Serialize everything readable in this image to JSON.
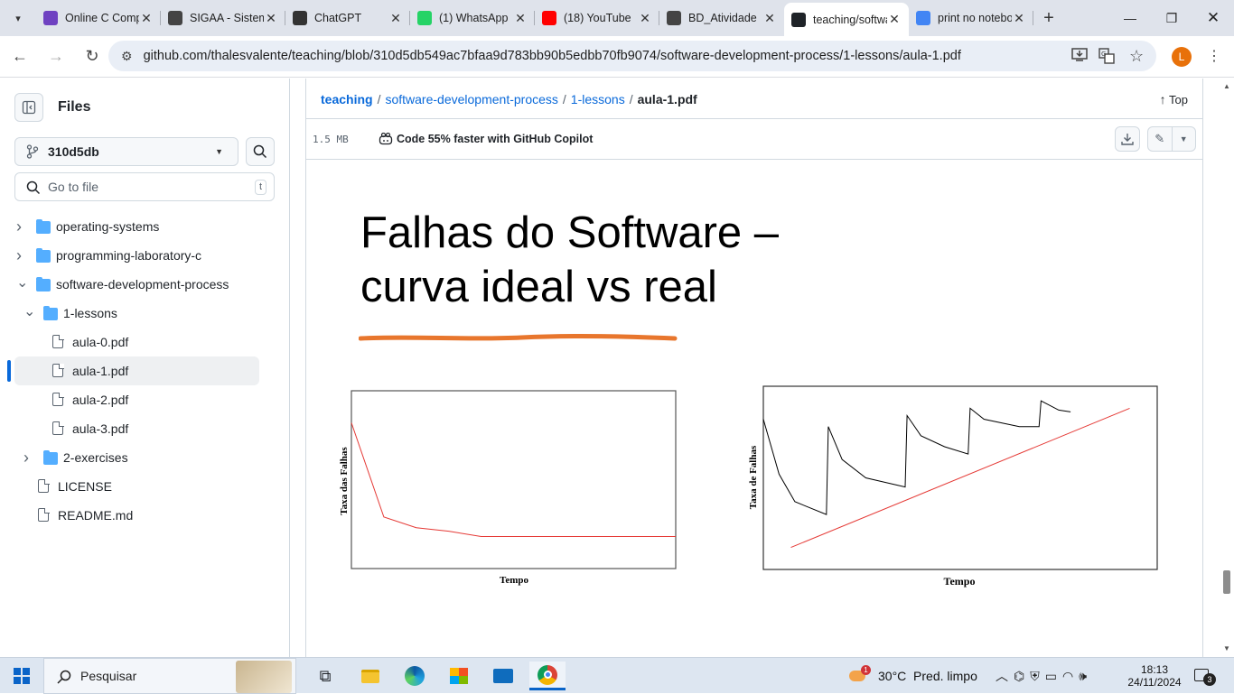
{
  "browser": {
    "tabs": [
      {
        "title": "Online C Compiler",
        "icon": "online-c-icon",
        "color": "#6f42c1"
      },
      {
        "title": "SIGAA - Sistema",
        "icon": "globe-icon",
        "color": "#444444"
      },
      {
        "title": "ChatGPT",
        "icon": "chatgpt-icon",
        "color": "#333333"
      },
      {
        "title": "(1) WhatsApp",
        "icon": "whatsapp-icon",
        "color": "#25d366"
      },
      {
        "title": "(18) YouTube",
        "icon": "youtube-icon",
        "color": "#ff0000"
      },
      {
        "title": "BD_Atividade",
        "icon": "globe-icon",
        "color": "#444444"
      },
      {
        "title": "teaching/software",
        "icon": "github-icon",
        "color": "#1f2328",
        "active": true
      },
      {
        "title": "print no notebook",
        "icon": "google-icon",
        "color": "#4285f4"
      }
    ],
    "url": "github.com/thalesvalente/teaching/blob/310d5db549ac7bfaa9d783bb90b5edbb70fb9074/software-development-process/1-lessons/aula-1.pdf",
    "profile_initial": "L"
  },
  "sidebar": {
    "title": "Files",
    "branch": "310d5db",
    "goto_placeholder": "Go to file",
    "goto_shortcut": "t",
    "tree": [
      {
        "label": "operating-systems",
        "type": "folder",
        "expanded": false,
        "depth": 0
      },
      {
        "label": "programming-laboratory-c",
        "type": "folder",
        "expanded": false,
        "depth": 0
      },
      {
        "label": "software-development-process",
        "type": "folder",
        "expanded": true,
        "depth": 0
      },
      {
        "label": "1-lessons",
        "type": "folder",
        "expanded": true,
        "depth": 1
      },
      {
        "label": "aula-0.pdf",
        "type": "file",
        "depth": 2
      },
      {
        "label": "aula-1.pdf",
        "type": "file",
        "depth": 2,
        "selected": true
      },
      {
        "label": "aula-2.pdf",
        "type": "file",
        "depth": 2
      },
      {
        "label": "aula-3.pdf",
        "type": "file",
        "depth": 2
      },
      {
        "label": "2-exercises",
        "type": "folder",
        "expanded": false,
        "depth": 1
      },
      {
        "label": "LICENSE",
        "type": "file",
        "depth": 0
      },
      {
        "label": "README.md",
        "type": "file",
        "depth": 0
      }
    ]
  },
  "main": {
    "breadcrumb": {
      "repo": "teaching",
      "parts": [
        "software-development-process",
        "1-lessons"
      ],
      "current": "aula-1.pdf"
    },
    "top_label": "Top",
    "file_size": "1.5 MB",
    "copilot_text": "Code 55% faster with GitHub Copilot"
  },
  "slide": {
    "title_line1": "Falhas do Software –",
    "title_line2": "curva ideal vs real",
    "underline_color": "#e8762d",
    "chart_left": {
      "ylabel": "Taxa das Falhas",
      "xlabel": "Tempo"
    },
    "chart_right": {
      "ylabel": "Taxa de Falhas",
      "xlabel": "Tempo"
    }
  },
  "chart_data": [
    {
      "type": "line",
      "xlabel": "Tempo",
      "ylabel": "Taxa das Falhas",
      "series": [
        {
          "color": "#e53935",
          "x": [
            0,
            0.1,
            0.2,
            0.3,
            0.4,
            0.5,
            0.6,
            0.8,
            1.0
          ],
          "y": [
            0.82,
            0.29,
            0.23,
            0.21,
            0.18,
            0.18,
            0.18,
            0.18,
            0.18
          ]
        }
      ]
    },
    {
      "type": "line",
      "xlabel": "Tempo",
      "ylabel": "Taxa de Falhas",
      "series": [
        {
          "color": "#000000",
          "x": [
            0.0,
            0.04,
            0.08,
            0.16,
            0.165,
            0.2,
            0.26,
            0.36,
            0.365,
            0.4,
            0.46,
            0.52,
            0.525,
            0.56,
            0.65,
            0.7,
            0.705,
            0.75,
            0.78
          ],
          "y": [
            0.82,
            0.52,
            0.37,
            0.3,
            0.78,
            0.6,
            0.5,
            0.45,
            0.84,
            0.73,
            0.67,
            0.63,
            0.88,
            0.82,
            0.78,
            0.78,
            0.92,
            0.87,
            0.86
          ]
        },
        {
          "color": "#e53935",
          "x": [
            0.07,
            0.93
          ],
          "y": [
            0.12,
            0.88
          ]
        }
      ]
    }
  ],
  "taskbar": {
    "search_label": "Pesquisar",
    "weather": "30°C  Pred. limpo",
    "weather_badge": "1",
    "time": "18:13",
    "date": "24/11/2024",
    "notif_count": "3"
  }
}
